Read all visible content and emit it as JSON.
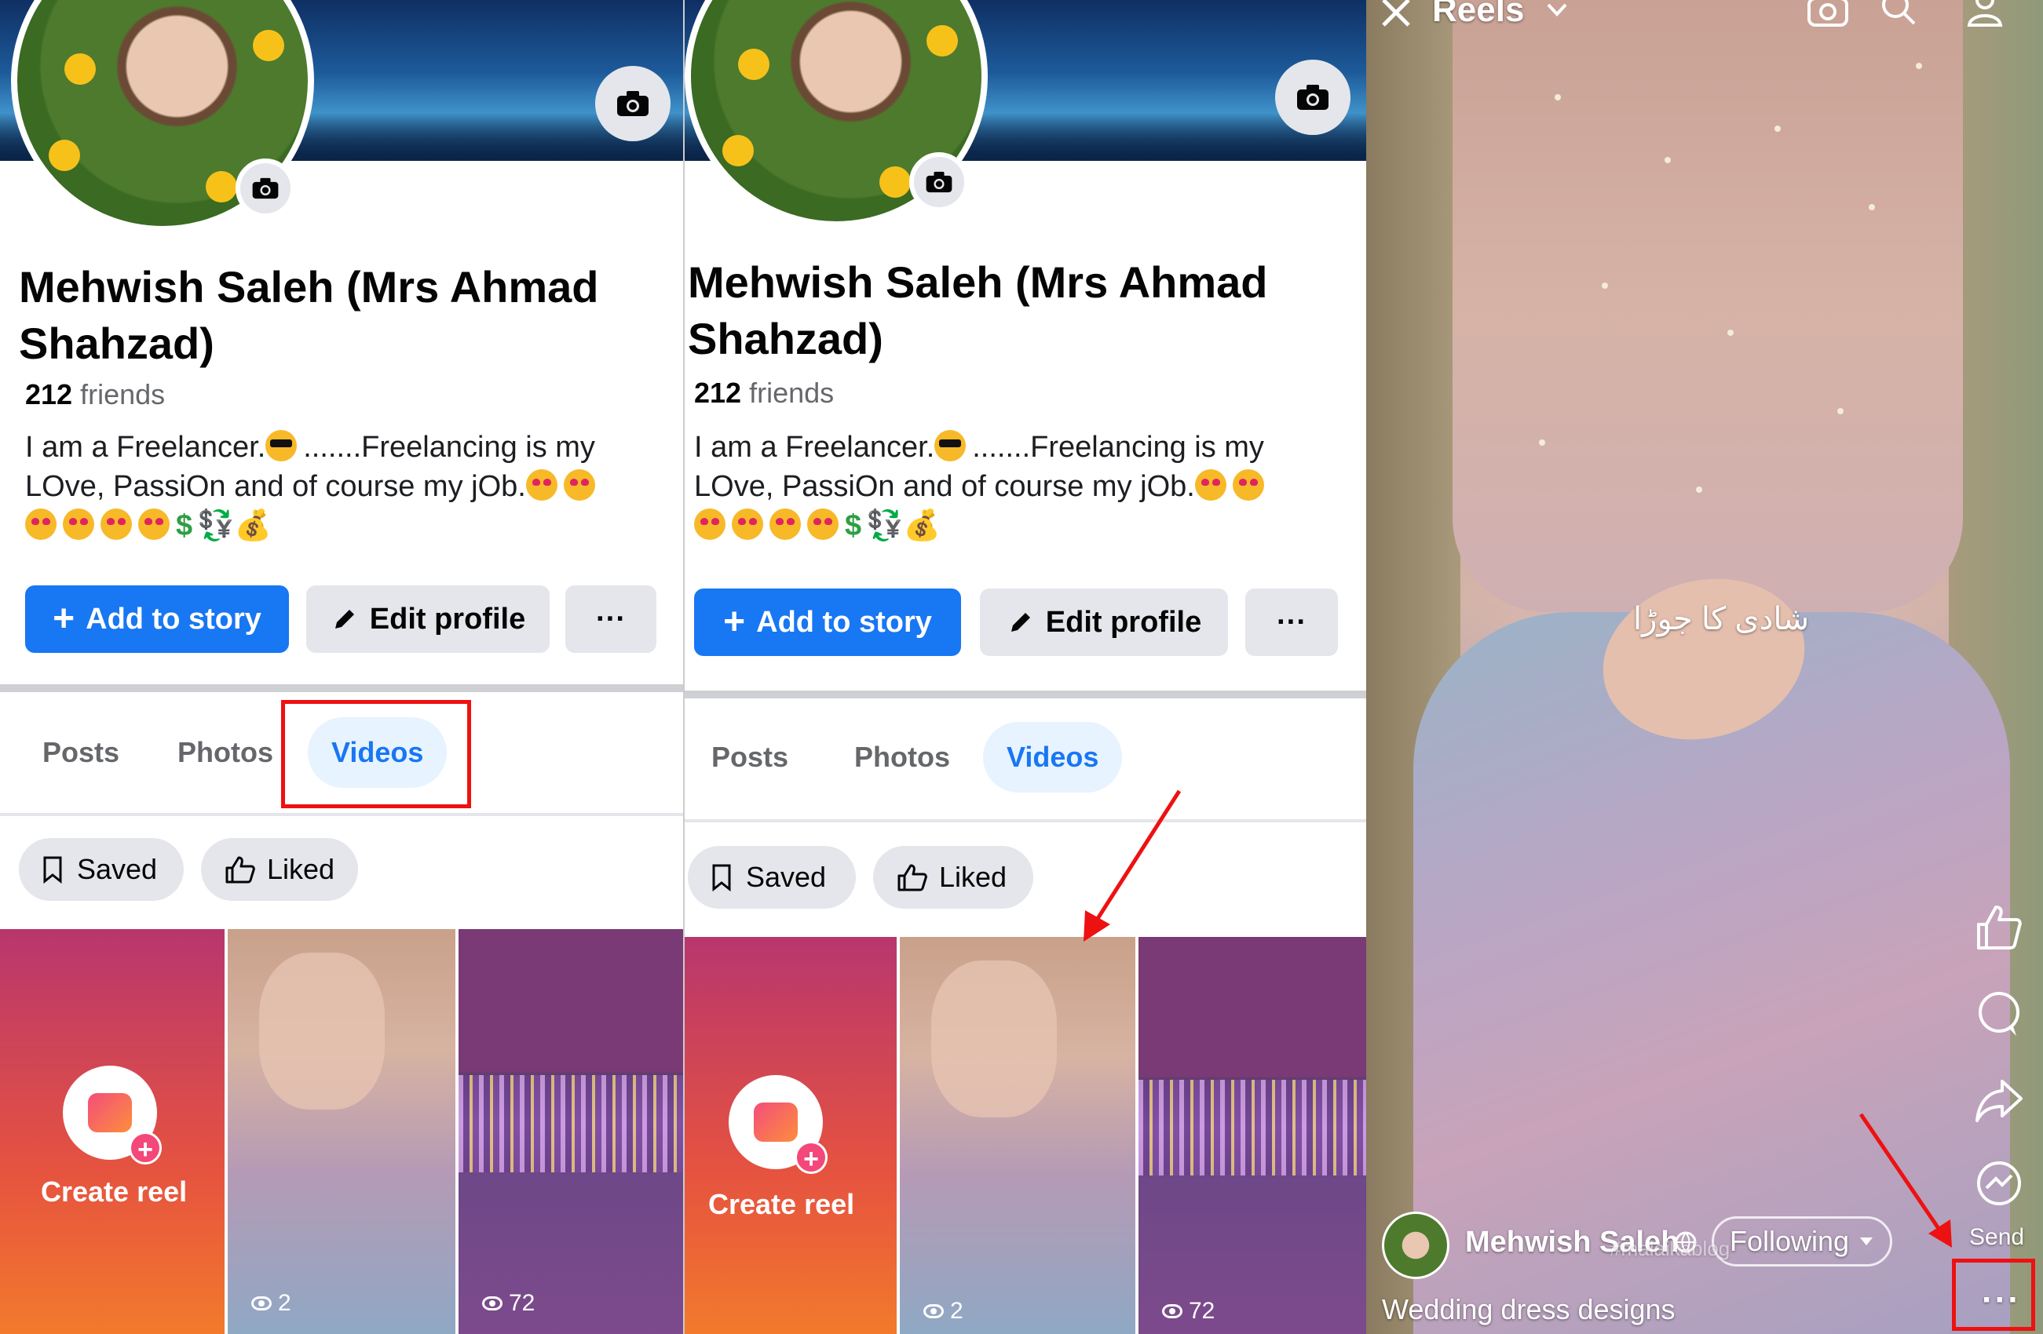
{
  "profile": {
    "name": "Mehwish Saleh (Mrs Ahmad Shahzad)",
    "friends_count": "212",
    "friends_label": "friends",
    "bio_line1": "I am a Freelancer.",
    "bio_line1b": ".......Freelancing is my",
    "bio_line2": "LOve, PassiOn and of course my jOb.",
    "currency_glyph": "$",
    "exchange_glyph": "💱",
    "money_glyph": "💰"
  },
  "actions": {
    "add_story": "Add to story",
    "edit_profile": "Edit profile",
    "more": "···"
  },
  "tabs": [
    "Posts",
    "Photos",
    "Videos"
  ],
  "active_tab": "Videos",
  "filters": {
    "saved": "Saved",
    "liked": "Liked"
  },
  "videos": {
    "create_reel": "Create reel",
    "tile1_views": "2",
    "tile2_views": "72"
  },
  "reels": {
    "title": "Reels",
    "overlay_text": "شادی کا جوڑا",
    "author": "Mehwish Saleh",
    "follow_state": "Following",
    "caption": "Wedding dress designs",
    "send_label": "Send",
    "more": "···",
    "watermark": "#malaikablog"
  },
  "colors": {
    "accent": "#1877f2",
    "active_tab_bg": "#e7f3ff",
    "highlight": "#ee1111"
  }
}
